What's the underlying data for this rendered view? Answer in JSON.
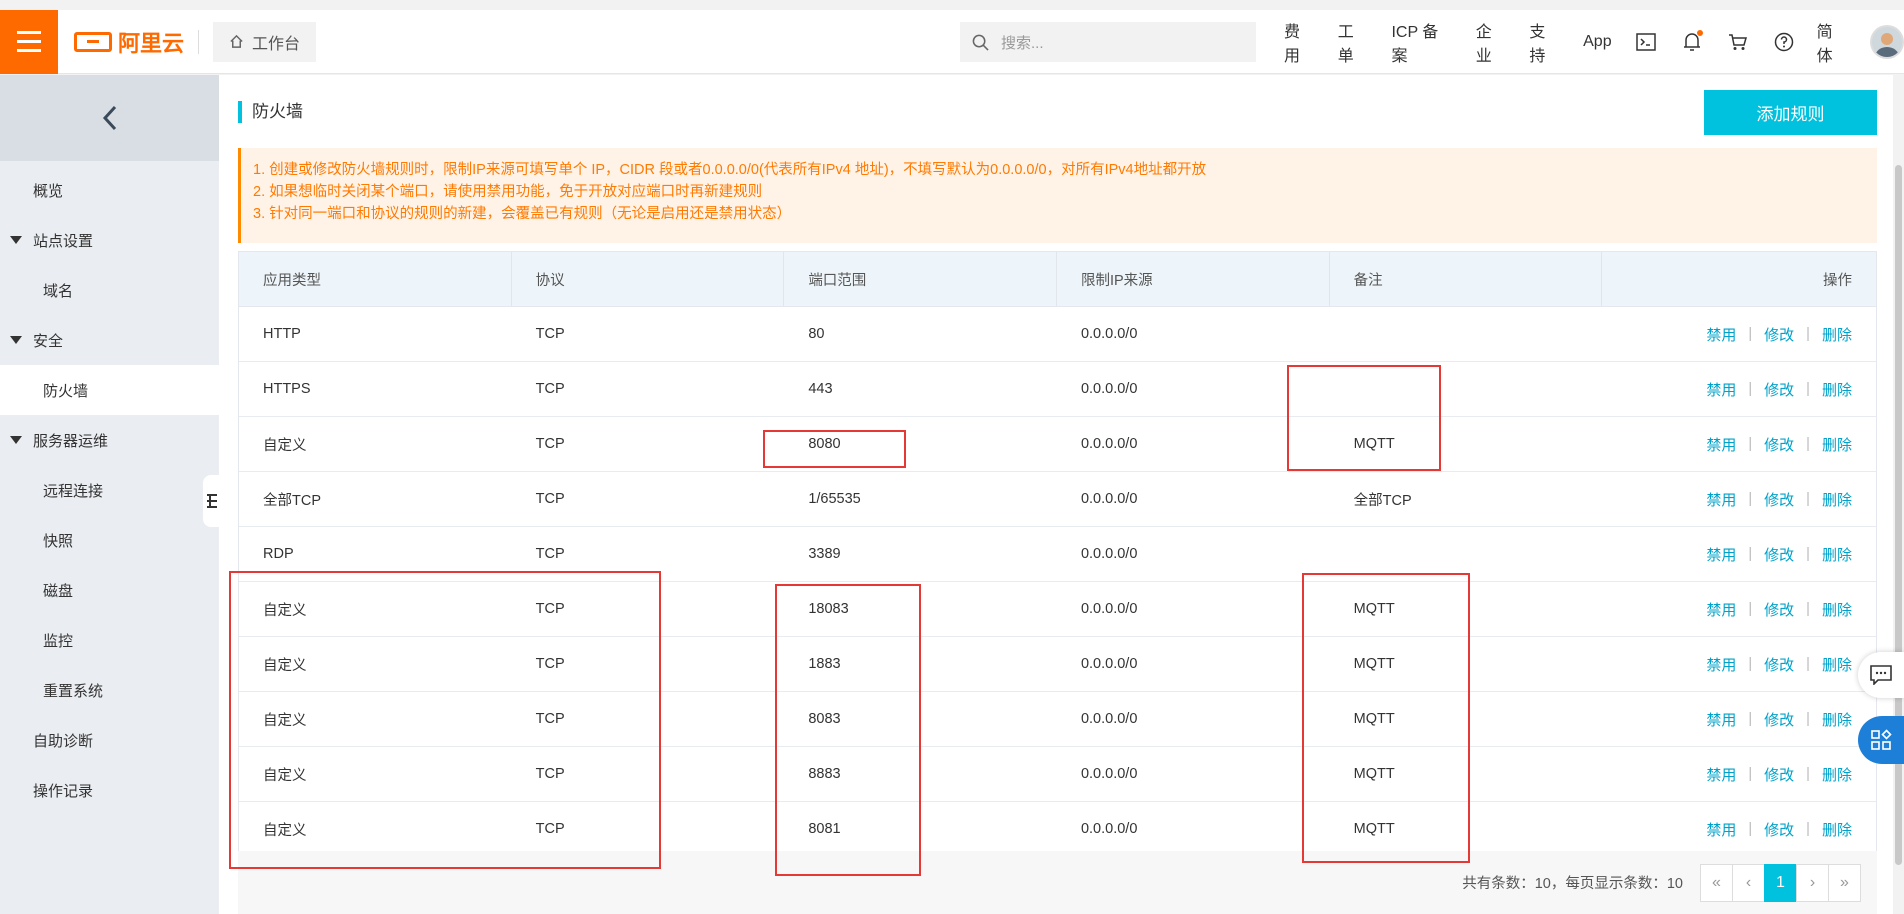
{
  "colors": {
    "brand": "#ff6a00",
    "accent": "#00c1de",
    "link": "#00a2ca",
    "annotation": "#e53935"
  },
  "header": {
    "logo_text": "阿里云",
    "workbench_label": "工作台",
    "search_placeholder": "搜索...",
    "nav": [
      "费用",
      "工单",
      "ICP 备案",
      "企业",
      "支持",
      "App"
    ],
    "language": "简体"
  },
  "sidebar": {
    "items": [
      {
        "label": "概览",
        "level": 1
      },
      {
        "label": "站点设置",
        "level": 1,
        "expanded": true
      },
      {
        "label": "域名",
        "level": 2
      },
      {
        "label": "安全",
        "level": 1,
        "expanded": true
      },
      {
        "label": "防火墙",
        "level": 2,
        "active": true
      },
      {
        "label": "服务器运维",
        "level": 1,
        "expanded": true
      },
      {
        "label": "远程连接",
        "level": 2
      },
      {
        "label": "快照",
        "level": 2
      },
      {
        "label": "磁盘",
        "level": 2
      },
      {
        "label": "监控",
        "level": 2
      },
      {
        "label": "重置系统",
        "level": 2
      },
      {
        "label": "自助诊断",
        "level": 1
      },
      {
        "label": "操作记录",
        "level": 1
      }
    ]
  },
  "main": {
    "title": "防火墙",
    "add_button": "添加规则",
    "notices": [
      "1. 创建或修改防火墙规则时，限制IP来源可填写单个 IP，CIDR 段或者0.0.0.0/0(代表所有IPv4 地址)，不填写默认为0.0.0.0/0，对所有IPv4地址都开放",
      "2. 如果想临时关闭某个端口，请使用禁用功能，免于开放对应端口时再新建规则",
      "3. 针对同一端口和协议的规则的新建，会覆盖已有规则（无论是启用还是禁用状态）"
    ],
    "columns": [
      "应用类型",
      "协议",
      "端口范围",
      "限制IP来源",
      "备注",
      "操作"
    ],
    "row_actions": [
      "禁用",
      "修改",
      "删除"
    ],
    "rows": [
      [
        "HTTP",
        "TCP",
        "80",
        "0.0.0.0/0",
        ""
      ],
      [
        "HTTPS",
        "TCP",
        "443",
        "0.0.0.0/0",
        ""
      ],
      [
        "自定义",
        "TCP",
        "8080",
        "0.0.0.0/0",
        "MQTT"
      ],
      [
        "全部TCP",
        "TCP",
        "1/65535",
        "0.0.0.0/0",
        "全部TCP"
      ],
      [
        "RDP",
        "TCP",
        "3389",
        "0.0.0.0/0",
        ""
      ],
      [
        "自定义",
        "TCP",
        "18083",
        "0.0.0.0/0",
        "MQTT"
      ],
      [
        "自定义",
        "TCP",
        "1883",
        "0.0.0.0/0",
        "MQTT"
      ],
      [
        "自定义",
        "TCP",
        "8083",
        "0.0.0.0/0",
        "MQTT"
      ],
      [
        "自定义",
        "TCP",
        "8883",
        "0.0.0.0/0",
        "MQTT"
      ],
      [
        "自定义",
        "TCP",
        "8081",
        "0.0.0.0/0",
        "MQTT"
      ]
    ],
    "pagination": {
      "summary": "共有条数：10，每页显示条数：10",
      "first": "«",
      "prev": "‹",
      "current": "1",
      "next": "›",
      "last": "»"
    }
  }
}
